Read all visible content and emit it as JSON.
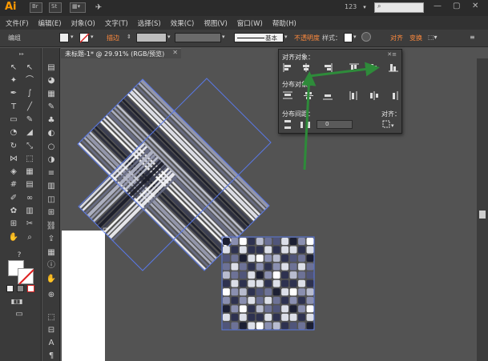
{
  "app": {
    "logo": "Ai",
    "workspace_num": "123"
  },
  "menubar": {
    "items": [
      "文件(F)",
      "编辑(E)",
      "对象(O)",
      "文字(T)",
      "选择(S)",
      "效果(C)",
      "视图(V)",
      "窗口(W)",
      "帮助(H)"
    ]
  },
  "controlbar": {
    "mode": "编组",
    "stroke_label": "描边",
    "stroke_style": "基本",
    "opacity_label": "不透明度",
    "style_label": "样式：",
    "align_label": "对齐",
    "transform_label": "变换"
  },
  "document": {
    "tab_title": "未标题-1* @ 29.91% (RGB/预览)"
  },
  "align_panel": {
    "section_align_objects": "对齐对象：",
    "section_distribute_objects": "分布对象：",
    "section_distribute_spacing": "分布间距：",
    "align_to_label": "对齐：",
    "spacing_value": "0"
  },
  "colors": {
    "accent_orange": "#ff8a3d",
    "annotation_arrow": "#2e8b3a",
    "selection_blue": "#5a78e6"
  }
}
